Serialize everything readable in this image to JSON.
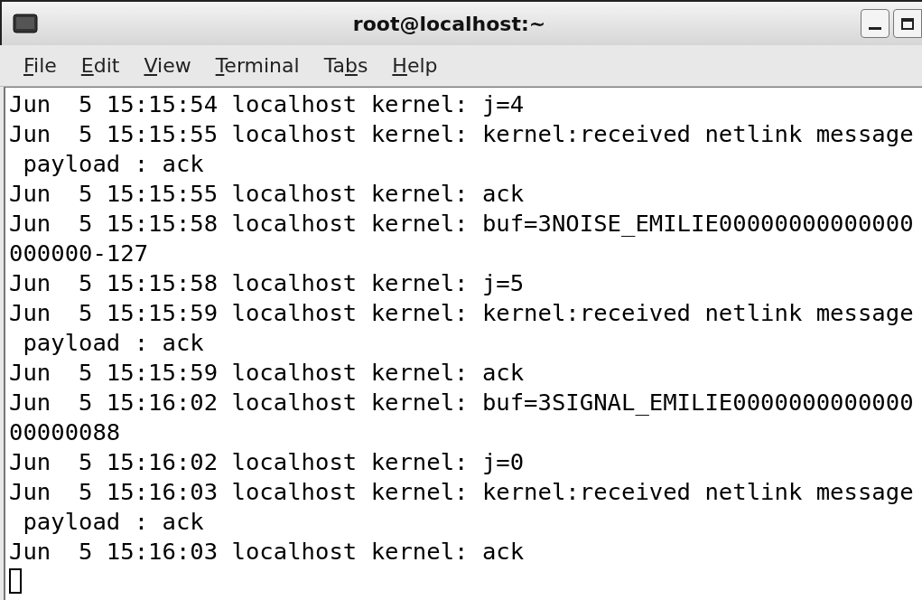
{
  "window": {
    "title": "root@localhost:~"
  },
  "menu": [
    {
      "key": "F",
      "post": "ile"
    },
    {
      "key": "E",
      "post": "dit"
    },
    {
      "key": "V",
      "post": "iew"
    },
    {
      "key": "T",
      "post": "erminal"
    },
    {
      "pre": "Ta",
      "key": "b",
      "post": "s"
    },
    {
      "key": "H",
      "post": "elp"
    }
  ],
  "terminal": {
    "lines": [
      "Jun  5 15:15:54 localhost kernel: j=4",
      "Jun  5 15:15:55 localhost kernel: kernel:received netlink message",
      " payload : ack",
      "Jun  5 15:15:55 localhost kernel: ack",
      "Jun  5 15:15:58 localhost kernel: buf=3NOISE_EMILIE00000000000000",
      "000000-127",
      "Jun  5 15:15:58 localhost kernel: j=5",
      "Jun  5 15:15:59 localhost kernel: kernel:received netlink message",
      " payload : ack",
      "Jun  5 15:15:59 localhost kernel: ack",
      "Jun  5 15:16:02 localhost kernel: buf=3SIGNAL_EMILIE0000000000000",
      "00000088",
      "Jun  5 15:16:02 localhost kernel: j=0",
      "Jun  5 15:16:03 localhost kernel: kernel:received netlink message",
      " payload : ack",
      "Jun  5 15:16:03 localhost kernel: ack"
    ],
    "cursor": true
  }
}
